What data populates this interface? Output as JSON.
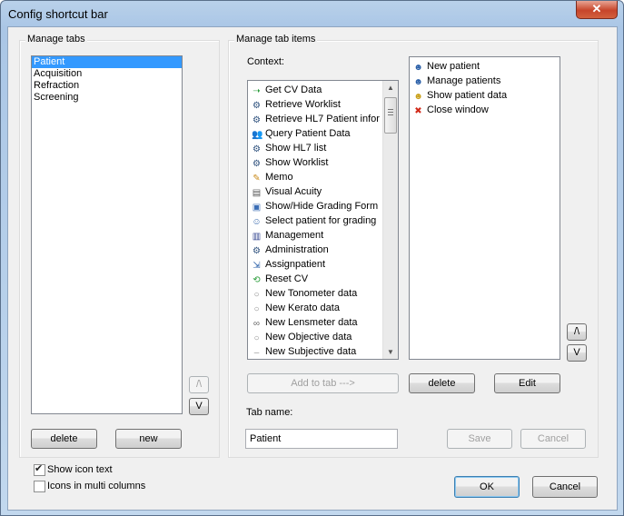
{
  "window": {
    "title": "Config shortcut bar",
    "close_label": "✕"
  },
  "manage_tabs": {
    "title": "Manage tabs",
    "items": [
      "Patient",
      "Acquisition",
      "Refraction",
      "Screening"
    ],
    "selected": "Patient",
    "up_label": "/\\",
    "down_label": "V",
    "delete_label": "delete",
    "new_label": "new"
  },
  "manage_items": {
    "title": "Manage tab items",
    "context_label": "Context:",
    "context_items": [
      {
        "label": "Get CV Data",
        "icon": "arrow-right-icon"
      },
      {
        "label": "Retrieve Worklist",
        "icon": "gear-icon"
      },
      {
        "label": "Retrieve HL7 Patient infor",
        "icon": "gear-icon"
      },
      {
        "label": "Query Patient Data",
        "icon": "users-icon"
      },
      {
        "label": "Show HL7 list",
        "icon": "gear-icon"
      },
      {
        "label": "Show Worklist",
        "icon": "gear-icon"
      },
      {
        "label": "Memo",
        "icon": "pencil-icon"
      },
      {
        "label": "Visual Acuity",
        "icon": "chart-icon"
      },
      {
        "label": "Show/Hide Grading Form",
        "icon": "form-icon"
      },
      {
        "label": "Select patient for grading",
        "icon": "user-icon"
      },
      {
        "label": "Management",
        "icon": "book-icon"
      },
      {
        "label": "Administration",
        "icon": "gear-icon"
      },
      {
        "label": "Assignpatient",
        "icon": "assign-icon"
      },
      {
        "label": "Reset CV",
        "icon": "reset-icon"
      },
      {
        "label": "New Tonometer data",
        "icon": "circle-icon"
      },
      {
        "label": "New Kerato data",
        "icon": "circle-icon"
      },
      {
        "label": "New Lensmeter data",
        "icon": "lens-icon"
      },
      {
        "label": "New Objective data",
        "icon": "circle-icon"
      },
      {
        "label": "New Subjective data",
        "icon": "dash-icon"
      }
    ],
    "tab_items": [
      {
        "label": "New patient",
        "icon": "user-add-icon"
      },
      {
        "label": "Manage patients",
        "icon": "user-list-icon"
      },
      {
        "label": "Show patient data",
        "icon": "user-data-icon"
      },
      {
        "label": "Close window",
        "icon": "close-red-icon"
      }
    ],
    "add_to_tab_label": "Add to tab --->",
    "delete_label": "delete",
    "edit_label": "Edit",
    "up_label": "/\\",
    "down_label": "V",
    "tab_name_label": "Tab name:",
    "tab_name_value": "Patient",
    "save_label": "Save",
    "cancel_label": "Cancel"
  },
  "options": {
    "show_icon_text_label": "Show icon text",
    "show_icon_text_checked": true,
    "icons_multi_columns_label": "Icons in multi columns",
    "icons_multi_columns_checked": false
  },
  "footer": {
    "ok_label": "OK",
    "cancel_label": "Cancel"
  },
  "colors": {
    "selection": "#3399ff",
    "accent": "#3c7fb1"
  }
}
